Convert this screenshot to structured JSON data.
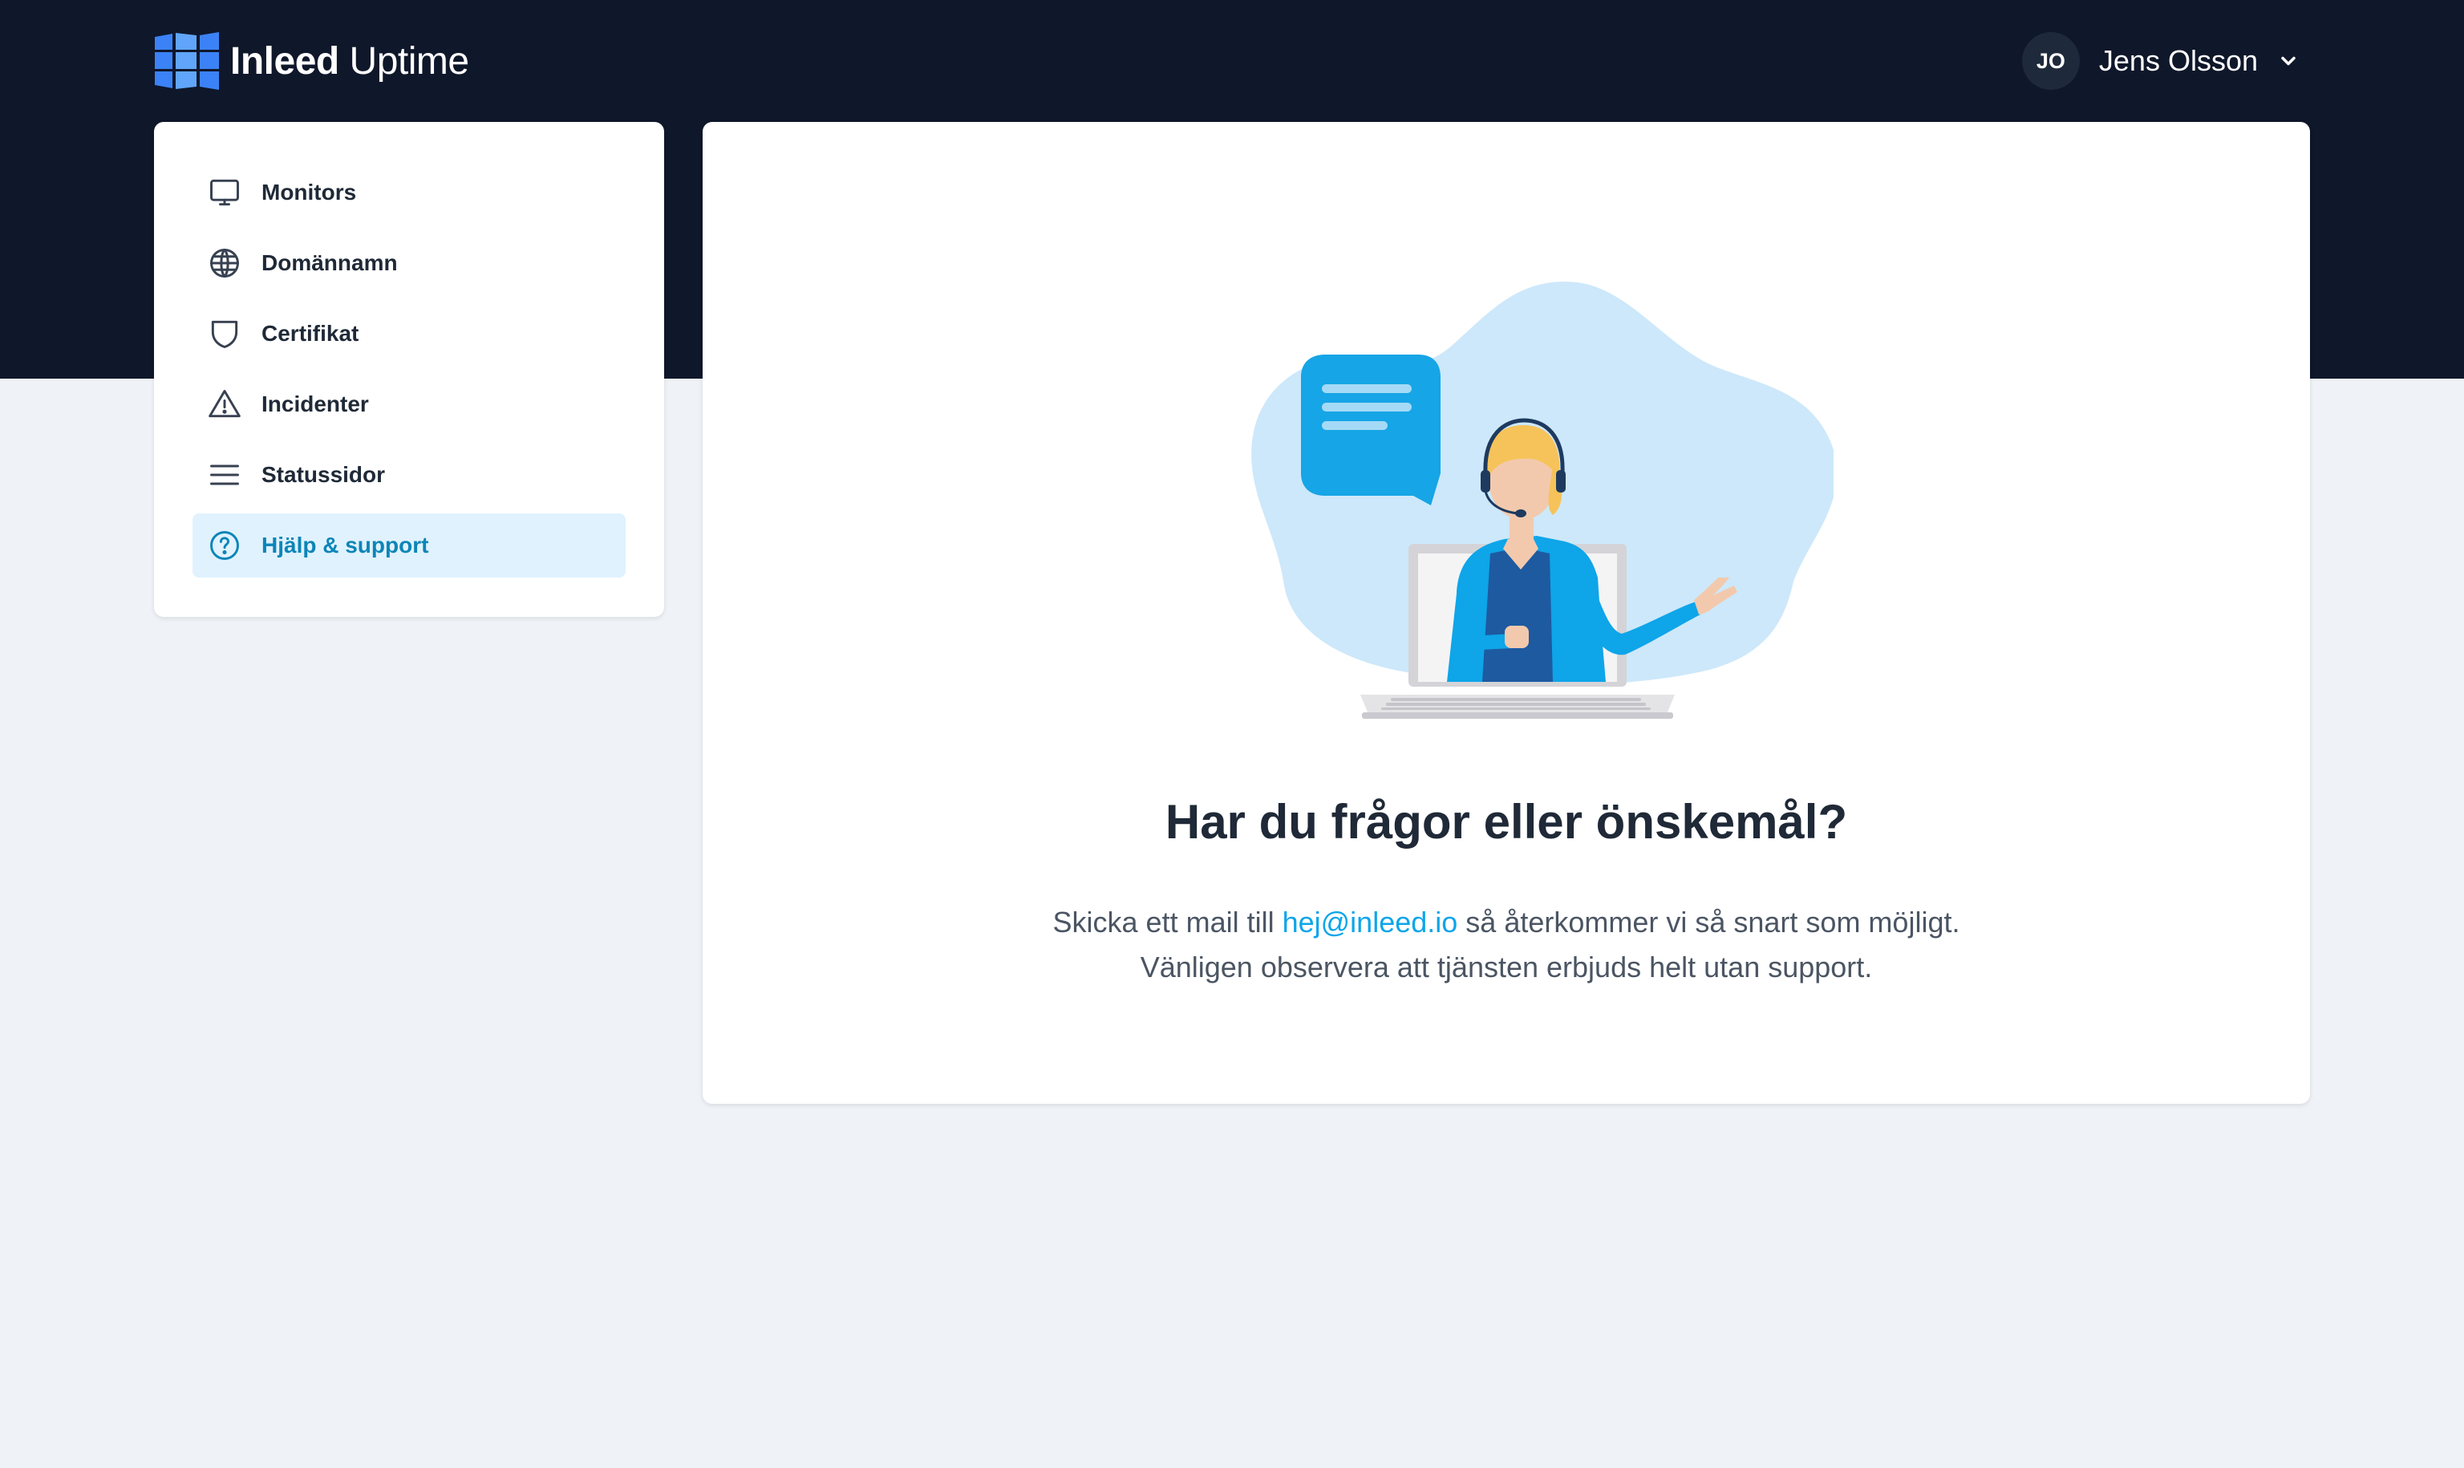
{
  "brand": {
    "name_bold": "Inleed",
    "name_regular": "Uptime",
    "icon": "inleed-logo-icon"
  },
  "user": {
    "initials": "JO",
    "name": "Jens Olsson",
    "icon": "chevron-down-icon"
  },
  "sidebar": {
    "items": [
      {
        "label": "Monitors",
        "icon": "monitor-icon",
        "active": false
      },
      {
        "label": "Domännamn",
        "icon": "globe-icon",
        "active": false
      },
      {
        "label": "Certifikat",
        "icon": "shield-icon",
        "active": false
      },
      {
        "label": "Incidenter",
        "icon": "warning-icon",
        "active": false
      },
      {
        "label": "Statussidor",
        "icon": "menu-lines-icon",
        "active": false
      },
      {
        "label": "Hjälp & support",
        "icon": "question-circle-icon",
        "active": true
      }
    ]
  },
  "main": {
    "illustration": "support-agent-illustration",
    "heading": "Har du frågor eller önskemål?",
    "text_before_link": "Skicka ett mail till ",
    "email": "hej@inleed.io",
    "text_after_link": " så återkommer vi så snart som möjligt.",
    "line2": "Vänligen observera att tjänsten erbjuds helt utan support."
  },
  "colors": {
    "header_bg": "#0f172a",
    "page_bg": "#eff2f6",
    "accent": "#0ea5e9",
    "active_bg": "#e0f2fe",
    "active_text": "#0c85b8"
  }
}
